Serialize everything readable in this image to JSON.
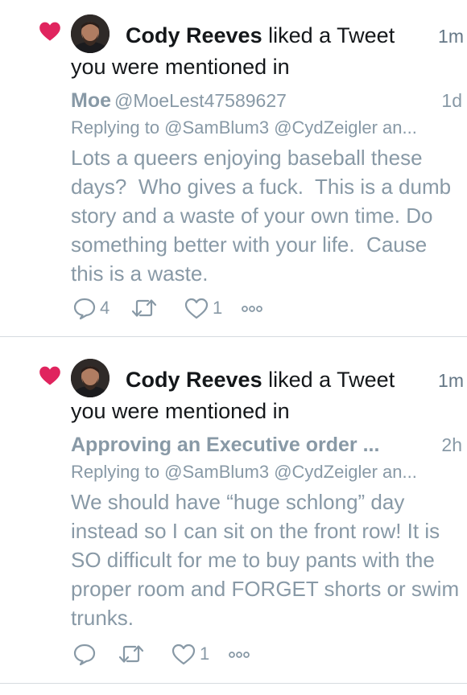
{
  "colors": {
    "heart": "#e0245e",
    "muted": "#8899a6",
    "text": "#14171a",
    "divider": "#d6dbe0"
  },
  "notifications": [
    {
      "icon": "heart-icon",
      "actor_name": "Cody Reeves",
      "action_text": " liked a Tweet",
      "action_text2": "you were mentioned in",
      "time": "1m",
      "quoted": {
        "name": "Moe",
        "handle": "@MoeLest47589627",
        "time": "1d",
        "replying_to": "Replying to @SamBlum3 @CydZeigler an...",
        "text": "Lots a queers enjoying baseball these days?  Who gives a fuck.  This is a dumb story and a waste of your own time. Do something better with your life.  Cause this is a waste.",
        "reply_count": "4",
        "retweet_count": "",
        "like_count": "1"
      }
    },
    {
      "icon": "heart-icon",
      "actor_name": "Cody Reeves",
      "action_text": " liked a Tweet",
      "action_text2": "you were mentioned in",
      "time": "1m",
      "quoted": {
        "name": "Approving an Executive order ...",
        "handle": "",
        "time": "2h",
        "replying_to": "Replying to @SamBlum3 @CydZeigler an...",
        "text": "We should have “huge schlong” day instead so I can sit on the front row! It is SO difficult for me to buy pants with the proper room and FORGET shorts or swim trunks.",
        "reply_count": "",
        "retweet_count": "",
        "like_count": "1"
      }
    }
  ]
}
